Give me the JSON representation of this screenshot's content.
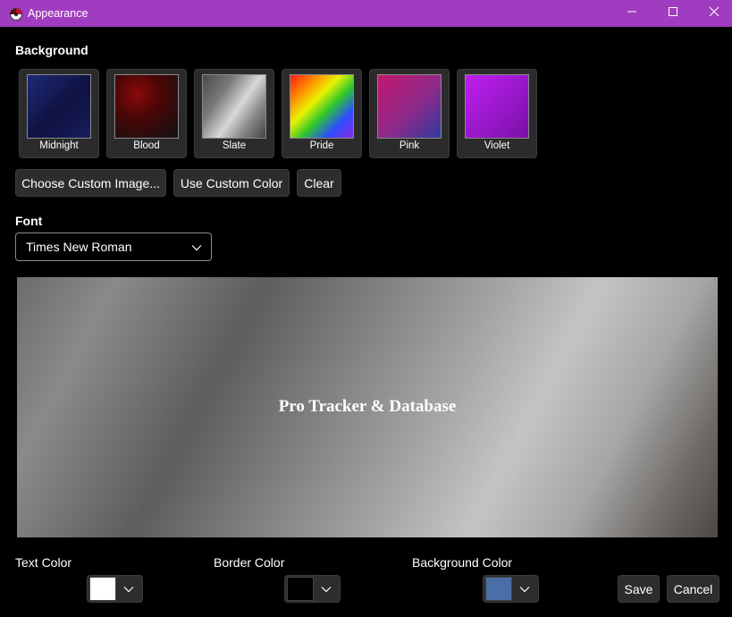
{
  "window": {
    "title": "Appearance",
    "icons": {
      "app": "app-logo-icon",
      "minimize": "minimize-icon",
      "maximize": "maximize-icon",
      "close": "close-icon"
    }
  },
  "background": {
    "heading": "Background",
    "presets": [
      {
        "label": "Midnight",
        "colors": [
          "#1e2a78",
          "#0e1140",
          "#1a1f5e"
        ]
      },
      {
        "label": "Blood",
        "colors": [
          "#8a0a0a",
          "#3a0505",
          "#141010"
        ]
      },
      {
        "label": "Slate",
        "colors": [
          "#5a5a5a",
          "#d0d0d0",
          "#4a4a4a"
        ]
      },
      {
        "label": "Pride",
        "colors": [
          "#ff1a1a",
          "#ffb300",
          "#e8f200",
          "#2ec82e",
          "#2b4dff",
          "#8a2be2"
        ]
      },
      {
        "label": "Pink",
        "colors": [
          "#c2186e",
          "#8e2a8a",
          "#2f3b9c"
        ]
      },
      {
        "label": "Violet",
        "colors": [
          "#c11df0",
          "#9416c4",
          "#7a10a6"
        ]
      }
    ],
    "buttons": {
      "custom_image": "Choose Custom Image...",
      "custom_color": "Use Custom Color",
      "clear": "Clear"
    }
  },
  "font": {
    "heading": "Font",
    "selected": "Times New Roman"
  },
  "preview": {
    "text": "Pro Tracker & Database"
  },
  "colors": {
    "text": {
      "label": "Text Color",
      "value": "#ffffff"
    },
    "border": {
      "label": "Border Color",
      "value": "#000000"
    },
    "background": {
      "label": "Background Color",
      "value": "#4a6ea6"
    }
  },
  "actions": {
    "save": "Save",
    "cancel": "Cancel"
  },
  "theme": {
    "titlebar": "#a03cbf",
    "window_bg": "#000000"
  }
}
